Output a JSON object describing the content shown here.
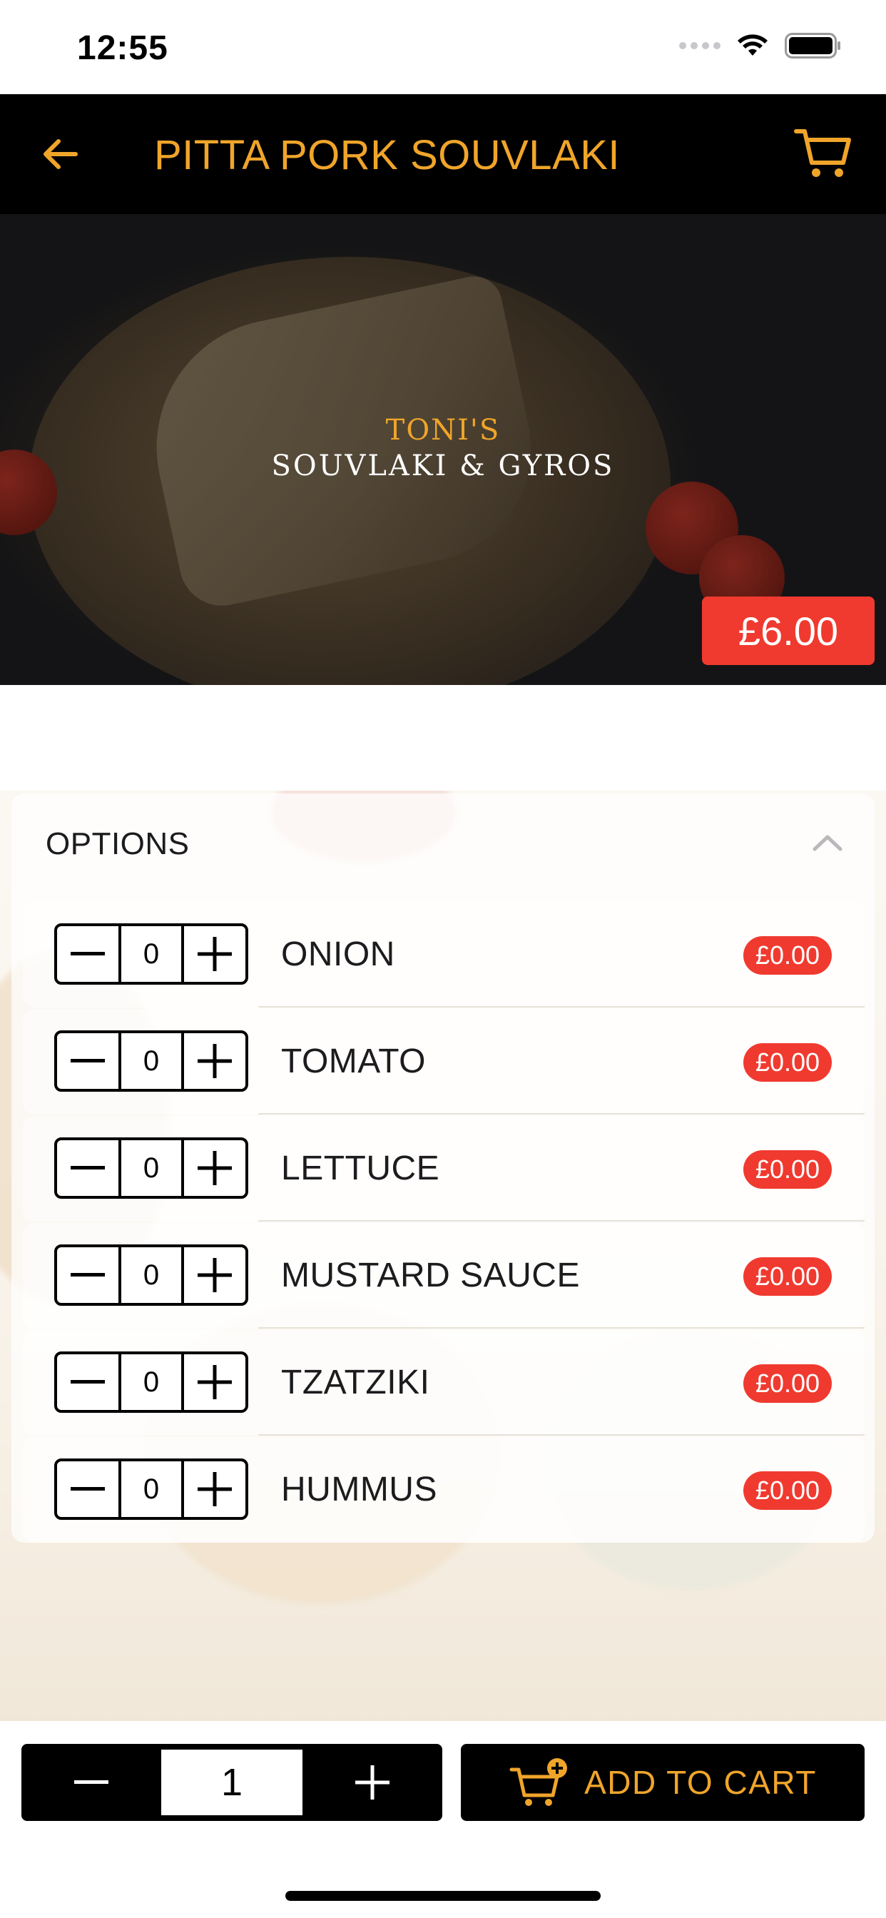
{
  "status_bar": {
    "time": "12:55"
  },
  "header": {
    "title": "PITTA PORK SOUVLAKI"
  },
  "hero": {
    "logo_line1": "TONI'S",
    "logo_line2": "SOUVLAKI & GYROS",
    "price": "£6.00"
  },
  "options": {
    "title": "OPTIONS",
    "items": [
      {
        "name": "ONION",
        "quantity": "0",
        "price": "£0.00"
      },
      {
        "name": "TOMATO",
        "quantity": "0",
        "price": "£0.00"
      },
      {
        "name": "LETTUCE",
        "quantity": "0",
        "price": "£0.00"
      },
      {
        "name": "MUSTARD SAUCE",
        "quantity": "0",
        "price": "£0.00"
      },
      {
        "name": "TZATZIKI",
        "quantity": "0",
        "price": "£0.00"
      },
      {
        "name": "HUMMUS",
        "quantity": "0",
        "price": "£0.00"
      }
    ]
  },
  "bottom_bar": {
    "quantity": "1",
    "add_to_cart_label": "ADD TO CART"
  },
  "icons": {
    "back": "arrow-left-icon",
    "cart": "cart-icon",
    "collapse": "chevron-up-icon",
    "minus": "minus-icon",
    "plus": "plus-icon",
    "add_to_cart": "cart-plus-icon"
  },
  "colors": {
    "accent": "#f0a52a",
    "price_badge": "#f03a2f",
    "nav_background": "#000000"
  }
}
